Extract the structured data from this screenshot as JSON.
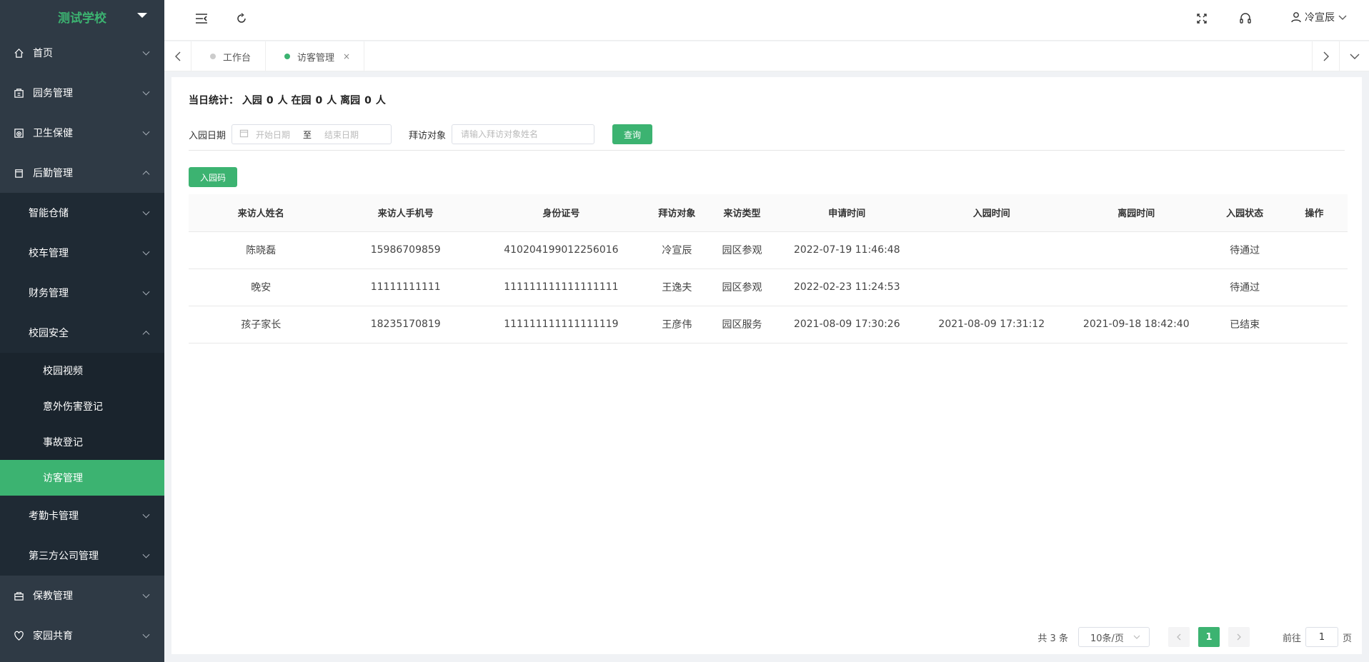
{
  "sidebar": {
    "school_name": "测试学校",
    "menu": {
      "home": "首页",
      "garden_affairs": "园务管理",
      "health": "卫生保健",
      "logistics": "后勤管理",
      "smart_storage": "智能仓储",
      "school_bus": "校车管理",
      "finance": "财务管理",
      "campus_security": "校园安全",
      "campus_video": "校园视频",
      "accident_injury": "意外伤害登记",
      "incident_register": "事故登记",
      "visitor_mgmt": "访客管理",
      "attendance_card": "考勤卡管理",
      "third_party": "第三方公司管理",
      "fee_mgmt": "保教管理",
      "home_school": "家园共育"
    }
  },
  "header": {
    "user_name": "冷宣辰"
  },
  "tabs": [
    {
      "label": "工作台"
    },
    {
      "label": "访客管理",
      "close": "×"
    }
  ],
  "stats": {
    "prefix": "当日统计：",
    "enter_label": "入园",
    "enter_count": "0",
    "in_label": "人 在园",
    "in_count": "0",
    "leave_label": "人 离园",
    "leave_count": "0",
    "suffix": "人"
  },
  "filter": {
    "date_label": "入园日期",
    "start_placeholder": "开始日期",
    "range_sep": "至",
    "end_placeholder": "结束日期",
    "target_label": "拜访对象",
    "target_placeholder": "请输入拜访对象姓名",
    "query_button": "查询"
  },
  "qr_button": "入园码",
  "table": {
    "columns": [
      "来访人姓名",
      "来访人手机号",
      "身份证号",
      "拜访对象",
      "来访类型",
      "申请时间",
      "入园时间",
      "离园时间",
      "入园状态",
      "操作"
    ],
    "rows": [
      [
        "陈晓磊",
        "15986709859",
        "410204199012256016",
        "冷宣辰",
        "园区参观",
        "2022-07-19 11:46:48",
        "",
        "",
        "待通过",
        ""
      ],
      [
        "晚安",
        "11111111111",
        "111111111111111111",
        "王逸夫",
        "园区参观",
        "2022-02-23 11:24:53",
        "",
        "",
        "待通过",
        ""
      ],
      [
        "孩子家长",
        "18235170819",
        "111111111111111119",
        "王彦伟",
        "园区服务",
        "2021-08-09 17:30:26",
        "2021-08-09 17:31:12",
        "2021-09-18 18:42:40",
        "已结束",
        ""
      ]
    ]
  },
  "pagination": {
    "total": "共 3 条",
    "page_size": "10条/页",
    "current_page": "1",
    "goto_label": "前往",
    "goto_value": "1",
    "page_unit": "页"
  },
  "colors": {
    "accent": "#3cb371",
    "sidebar_bg": "#2f3a45"
  },
  "icons": [
    "menu-fold-icon",
    "refresh-icon",
    "fullscreen-icon",
    "headset-icon",
    "user-icon",
    "home-icon",
    "building-icon",
    "health-icon",
    "logistics-icon",
    "fee-icon",
    "home-school-icon",
    "calendar-icon"
  ]
}
